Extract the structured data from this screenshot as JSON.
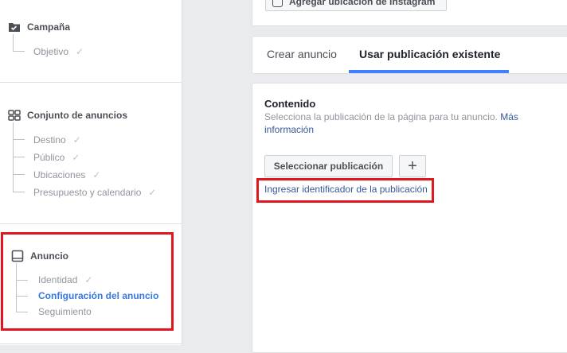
{
  "sidebar": {
    "campaign": {
      "title": "Campaña",
      "items": [
        {
          "label": "Objetivo",
          "done": true
        }
      ]
    },
    "adset": {
      "title": "Conjunto de anuncios",
      "items": [
        {
          "label": "Destino",
          "done": true
        },
        {
          "label": "Público",
          "done": true
        },
        {
          "label": "Ubicaciones",
          "done": true
        },
        {
          "label": "Presupuesto y calendario",
          "done": true
        }
      ]
    },
    "ad": {
      "title": "Anuncio",
      "items": [
        {
          "label": "Identidad",
          "done": true
        },
        {
          "label": "Configuración del anuncio",
          "active": true
        },
        {
          "label": "Seguimiento"
        }
      ]
    }
  },
  "top": {
    "instagram_button": "Agregar ubicación de Instagram"
  },
  "tabs": [
    {
      "label": "Crear anuncio",
      "active": false
    },
    {
      "label": "Usar publicación existente",
      "active": true
    }
  ],
  "content": {
    "title": "Contenido",
    "description": "Selecciona la publicación de la página para tu anuncio.",
    "more_link": "Más información",
    "select_button": "Seleccionar publicación",
    "add_button": "+",
    "id_link": "Ingresar identificador de la publicación"
  },
  "colors": {
    "accent": "#4080ff",
    "highlight": "#e0171e",
    "link": "#365899"
  },
  "check_glyph": "✓"
}
